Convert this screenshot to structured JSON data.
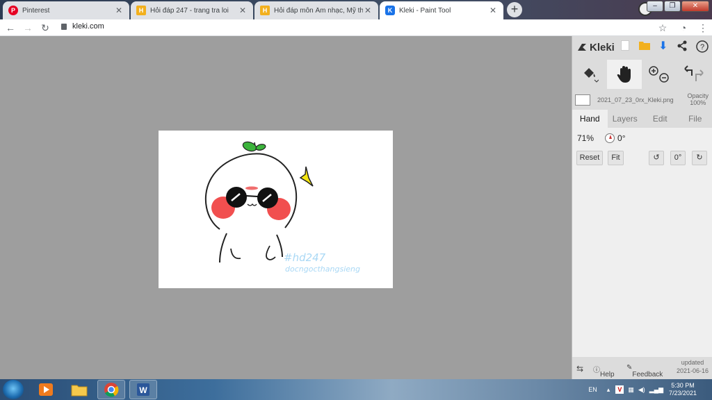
{
  "browser": {
    "tabs": [
      {
        "title": "Pinterest",
        "icon": "pinterest-icon",
        "active": false
      },
      {
        "title": "Hỏi đáp 247 - trang tra loi",
        "icon": "hoidap-icon",
        "active": false
      },
      {
        "title": "Hỏi đáp môn Âm nhạc, Mỹ thuật",
        "icon": "hoidap-icon",
        "active": false
      },
      {
        "title": "Kleki - Paint Tool",
        "icon": "kleki-icon",
        "active": true
      }
    ],
    "new_tab_label": "+",
    "url": "kleki.com"
  },
  "kleki": {
    "logo_text": "Kleki",
    "file_name": "2021_07_23_0rx_Kleki.png",
    "opacity_label": "Opacity",
    "opacity_value": "100%",
    "tabs": [
      "Hand",
      "Layers",
      "Edit",
      "File"
    ],
    "active_tab": "Hand",
    "zoom": "71%",
    "rotation": "0°",
    "buttons": {
      "reset": "Reset",
      "fit": "Fit",
      "rotate_value": "0°"
    },
    "footer": {
      "help": "Help",
      "feedback": "Feedback",
      "updated_label": "updated",
      "updated_date": "2021-06-16"
    }
  },
  "drawing": {
    "watermark_line1": "#hd247",
    "watermark_line2": "docngocthangsieng"
  },
  "taskbar": {
    "language": "EN",
    "time": "5:30 PM",
    "date": "7/23/2021"
  },
  "colors": {
    "workspace": "#9e9e9e",
    "panel": "#dcdcdc",
    "blush": "#f03c3c",
    "sprout": "#3cb43c",
    "sparkle": "#f5e611",
    "watermark": "#a9d8f5"
  }
}
